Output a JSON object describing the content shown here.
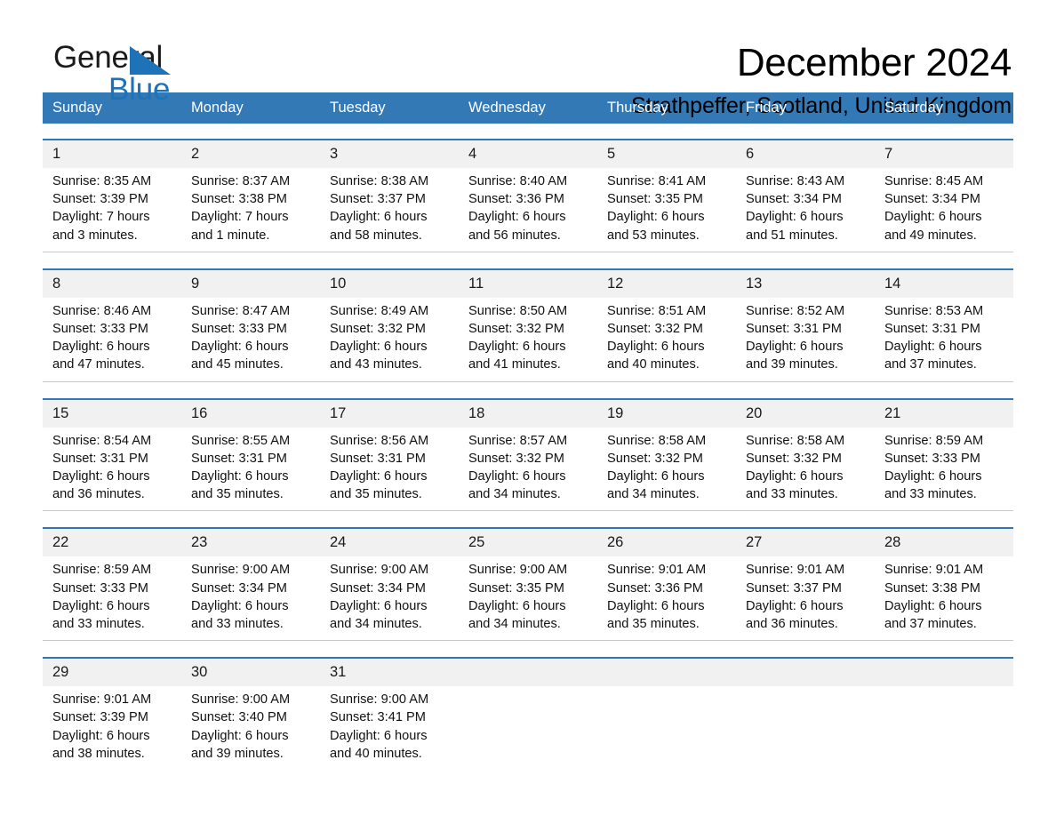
{
  "brand": {
    "name_part1": "General",
    "name_part2": "Blue",
    "triangle_color": "#1e72b8"
  },
  "header": {
    "month_title": "December 2024",
    "location": "Strathpeffer, Scotland, United Kingdom"
  },
  "colors": {
    "header_blue": "#3279b6",
    "row_divider_blue": "#2f77b5",
    "daynum_band": "#f1f1f1",
    "cell_background": "#ffffff",
    "text": "#111111"
  },
  "calendar": {
    "weekday_headers": [
      "Sunday",
      "Monday",
      "Tuesday",
      "Wednesday",
      "Thursday",
      "Friday",
      "Saturday"
    ],
    "weeks": [
      {
        "days": [
          {
            "num": "1",
            "sunrise": "Sunrise: 8:35 AM",
            "sunset": "Sunset: 3:39 PM",
            "daylight_l1": "Daylight: 7 hours",
            "daylight_l2": "and 3 minutes."
          },
          {
            "num": "2",
            "sunrise": "Sunrise: 8:37 AM",
            "sunset": "Sunset: 3:38 PM",
            "daylight_l1": "Daylight: 7 hours",
            "daylight_l2": "and 1 minute."
          },
          {
            "num": "3",
            "sunrise": "Sunrise: 8:38 AM",
            "sunset": "Sunset: 3:37 PM",
            "daylight_l1": "Daylight: 6 hours",
            "daylight_l2": "and 58 minutes."
          },
          {
            "num": "4",
            "sunrise": "Sunrise: 8:40 AM",
            "sunset": "Sunset: 3:36 PM",
            "daylight_l1": "Daylight: 6 hours",
            "daylight_l2": "and 56 minutes."
          },
          {
            "num": "5",
            "sunrise": "Sunrise: 8:41 AM",
            "sunset": "Sunset: 3:35 PM",
            "daylight_l1": "Daylight: 6 hours",
            "daylight_l2": "and 53 minutes."
          },
          {
            "num": "6",
            "sunrise": "Sunrise: 8:43 AM",
            "sunset": "Sunset: 3:34 PM",
            "daylight_l1": "Daylight: 6 hours",
            "daylight_l2": "and 51 minutes."
          },
          {
            "num": "7",
            "sunrise": "Sunrise: 8:45 AM",
            "sunset": "Sunset: 3:34 PM",
            "daylight_l1": "Daylight: 6 hours",
            "daylight_l2": "and 49 minutes."
          }
        ]
      },
      {
        "days": [
          {
            "num": "8",
            "sunrise": "Sunrise: 8:46 AM",
            "sunset": "Sunset: 3:33 PM",
            "daylight_l1": "Daylight: 6 hours",
            "daylight_l2": "and 47 minutes."
          },
          {
            "num": "9",
            "sunrise": "Sunrise: 8:47 AM",
            "sunset": "Sunset: 3:33 PM",
            "daylight_l1": "Daylight: 6 hours",
            "daylight_l2": "and 45 minutes."
          },
          {
            "num": "10",
            "sunrise": "Sunrise: 8:49 AM",
            "sunset": "Sunset: 3:32 PM",
            "daylight_l1": "Daylight: 6 hours",
            "daylight_l2": "and 43 minutes."
          },
          {
            "num": "11",
            "sunrise": "Sunrise: 8:50 AM",
            "sunset": "Sunset: 3:32 PM",
            "daylight_l1": "Daylight: 6 hours",
            "daylight_l2": "and 41 minutes."
          },
          {
            "num": "12",
            "sunrise": "Sunrise: 8:51 AM",
            "sunset": "Sunset: 3:32 PM",
            "daylight_l1": "Daylight: 6 hours",
            "daylight_l2": "and 40 minutes."
          },
          {
            "num": "13",
            "sunrise": "Sunrise: 8:52 AM",
            "sunset": "Sunset: 3:31 PM",
            "daylight_l1": "Daylight: 6 hours",
            "daylight_l2": "and 39 minutes."
          },
          {
            "num": "14",
            "sunrise": "Sunrise: 8:53 AM",
            "sunset": "Sunset: 3:31 PM",
            "daylight_l1": "Daylight: 6 hours",
            "daylight_l2": "and 37 minutes."
          }
        ]
      },
      {
        "days": [
          {
            "num": "15",
            "sunrise": "Sunrise: 8:54 AM",
            "sunset": "Sunset: 3:31 PM",
            "daylight_l1": "Daylight: 6 hours",
            "daylight_l2": "and 36 minutes."
          },
          {
            "num": "16",
            "sunrise": "Sunrise: 8:55 AM",
            "sunset": "Sunset: 3:31 PM",
            "daylight_l1": "Daylight: 6 hours",
            "daylight_l2": "and 35 minutes."
          },
          {
            "num": "17",
            "sunrise": "Sunrise: 8:56 AM",
            "sunset": "Sunset: 3:31 PM",
            "daylight_l1": "Daylight: 6 hours",
            "daylight_l2": "and 35 minutes."
          },
          {
            "num": "18",
            "sunrise": "Sunrise: 8:57 AM",
            "sunset": "Sunset: 3:32 PM",
            "daylight_l1": "Daylight: 6 hours",
            "daylight_l2": "and 34 minutes."
          },
          {
            "num": "19",
            "sunrise": "Sunrise: 8:58 AM",
            "sunset": "Sunset: 3:32 PM",
            "daylight_l1": "Daylight: 6 hours",
            "daylight_l2": "and 34 minutes."
          },
          {
            "num": "20",
            "sunrise": "Sunrise: 8:58 AM",
            "sunset": "Sunset: 3:32 PM",
            "daylight_l1": "Daylight: 6 hours",
            "daylight_l2": "and 33 minutes."
          },
          {
            "num": "21",
            "sunrise": "Sunrise: 8:59 AM",
            "sunset": "Sunset: 3:33 PM",
            "daylight_l1": "Daylight: 6 hours",
            "daylight_l2": "and 33 minutes."
          }
        ]
      },
      {
        "days": [
          {
            "num": "22",
            "sunrise": "Sunrise: 8:59 AM",
            "sunset": "Sunset: 3:33 PM",
            "daylight_l1": "Daylight: 6 hours",
            "daylight_l2": "and 33 minutes."
          },
          {
            "num": "23",
            "sunrise": "Sunrise: 9:00 AM",
            "sunset": "Sunset: 3:34 PM",
            "daylight_l1": "Daylight: 6 hours",
            "daylight_l2": "and 33 minutes."
          },
          {
            "num": "24",
            "sunrise": "Sunrise: 9:00 AM",
            "sunset": "Sunset: 3:34 PM",
            "daylight_l1": "Daylight: 6 hours",
            "daylight_l2": "and 34 minutes."
          },
          {
            "num": "25",
            "sunrise": "Sunrise: 9:00 AM",
            "sunset": "Sunset: 3:35 PM",
            "daylight_l1": "Daylight: 6 hours",
            "daylight_l2": "and 34 minutes."
          },
          {
            "num": "26",
            "sunrise": "Sunrise: 9:01 AM",
            "sunset": "Sunset: 3:36 PM",
            "daylight_l1": "Daylight: 6 hours",
            "daylight_l2": "and 35 minutes."
          },
          {
            "num": "27",
            "sunrise": "Sunrise: 9:01 AM",
            "sunset": "Sunset: 3:37 PM",
            "daylight_l1": "Daylight: 6 hours",
            "daylight_l2": "and 36 minutes."
          },
          {
            "num": "28",
            "sunrise": "Sunrise: 9:01 AM",
            "sunset": "Sunset: 3:38 PM",
            "daylight_l1": "Daylight: 6 hours",
            "daylight_l2": "and 37 minutes."
          }
        ]
      },
      {
        "days": [
          {
            "num": "29",
            "sunrise": "Sunrise: 9:01 AM",
            "sunset": "Sunset: 3:39 PM",
            "daylight_l1": "Daylight: 6 hours",
            "daylight_l2": "and 38 minutes."
          },
          {
            "num": "30",
            "sunrise": "Sunrise: 9:00 AM",
            "sunset": "Sunset: 3:40 PM",
            "daylight_l1": "Daylight: 6 hours",
            "daylight_l2": "and 39 minutes."
          },
          {
            "num": "31",
            "sunrise": "Sunrise: 9:00 AM",
            "sunset": "Sunset: 3:41 PM",
            "daylight_l1": "Daylight: 6 hours",
            "daylight_l2": "and 40 minutes."
          },
          {
            "num": "",
            "sunrise": "",
            "sunset": "",
            "daylight_l1": "",
            "daylight_l2": ""
          },
          {
            "num": "",
            "sunrise": "",
            "sunset": "",
            "daylight_l1": "",
            "daylight_l2": ""
          },
          {
            "num": "",
            "sunrise": "",
            "sunset": "",
            "daylight_l1": "",
            "daylight_l2": ""
          },
          {
            "num": "",
            "sunrise": "",
            "sunset": "",
            "daylight_l1": "",
            "daylight_l2": ""
          }
        ]
      }
    ]
  }
}
